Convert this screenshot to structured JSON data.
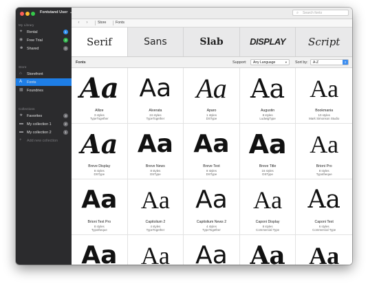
{
  "window": {
    "colors": {
      "sidebar": "#2b2b2d",
      "accent": "#1e7ee6"
    }
  },
  "sidebar": {
    "user": "Fontstand User",
    "user_chevron": "⌄",
    "sections": {
      "library": "My Library",
      "store": "Store",
      "collections": "Collections"
    },
    "library_items": [
      {
        "label": "Rental",
        "icon": "pin-icon",
        "badge": "1",
        "badge_color": "#2f8ff0"
      },
      {
        "label": "Free Trial",
        "icon": "eye-icon",
        "badge": "3",
        "badge_color": "#2fb54a"
      },
      {
        "label": "Shared",
        "icon": "people-icon",
        "badge": "0",
        "badge_color": "#6b6b6f"
      }
    ],
    "store_items": [
      {
        "label": "Storefront",
        "icon": "store-icon"
      },
      {
        "label": "Fonts",
        "icon": "type-icon"
      },
      {
        "label": "Foundries",
        "icon": "building-icon"
      }
    ],
    "collection_items": [
      {
        "label": "Favorites",
        "icon": "star-icon",
        "badge": "3"
      },
      {
        "label": "My collection 1",
        "icon": "folder-icon",
        "badge": "2"
      },
      {
        "label": "My collection 2",
        "icon": "folder-icon",
        "badge": "1"
      },
      {
        "label": "Add new collection",
        "icon": "plus-icon"
      }
    ]
  },
  "toolbar": {
    "search_placeholder": "Search fonts"
  },
  "breadcrumb": {
    "back": "‹",
    "forward": "›",
    "items": [
      "Store",
      "Fonts"
    ]
  },
  "categories": [
    "Serif",
    "Sans",
    "Slab",
    "DISPLAY",
    "Script"
  ],
  "filter_bar": {
    "title": "Fonts",
    "support_label": "Support:",
    "support_value": "Any Language",
    "sort_label": "Sort by:",
    "sort_value": "A-Z"
  },
  "specimen": "Aa",
  "fonts": [
    {
      "name": "Allize",
      "styles": "3 styles",
      "foundry": "TypeTogether"
    },
    {
      "name": "Alverata",
      "styles": "24 styles",
      "foundry": "TypeTogether"
    },
    {
      "name": "Aparo",
      "styles": "1 styles",
      "foundry": "DSType"
    },
    {
      "name": "Augustin",
      "styles": "8 styles",
      "foundry": "LudwigType"
    },
    {
      "name": "Bookmania",
      "styles": "10 styles",
      "foundry": "Mark Simonson Studio"
    },
    {
      "name": "Breve Display",
      "styles": "8 styles",
      "foundry": "DSType"
    },
    {
      "name": "Breve News",
      "styles": "8 styles",
      "foundry": "DSType"
    },
    {
      "name": "Breve Text",
      "styles": "8 styles",
      "foundry": "DSType"
    },
    {
      "name": "Breve Title",
      "styles": "16 styles",
      "foundry": "DSType"
    },
    {
      "name": "Brioni Pro",
      "styles": "8 styles",
      "foundry": "Typotheque"
    },
    {
      "name": "Brioni Text Pro",
      "styles": "8 styles",
      "foundry": "Typotheque"
    },
    {
      "name": "Capitolium 2",
      "styles": "4 styles",
      "foundry": "TypeTogether"
    },
    {
      "name": "Capitolium News 2",
      "styles": "4 styles",
      "foundry": "TypeTogether"
    },
    {
      "name": "Caponi Display",
      "styles": "8 styles",
      "foundry": "Commercial Type"
    },
    {
      "name": "Caponi Text",
      "styles": "6 styles",
      "foundry": "Commercial Type"
    },
    {
      "name": "",
      "styles": "",
      "foundry": ""
    },
    {
      "name": "",
      "styles": "",
      "foundry": ""
    },
    {
      "name": "",
      "styles": "",
      "foundry": ""
    },
    {
      "name": "",
      "styles": "",
      "foundry": ""
    },
    {
      "name": "",
      "styles": "",
      "foundry": ""
    }
  ]
}
